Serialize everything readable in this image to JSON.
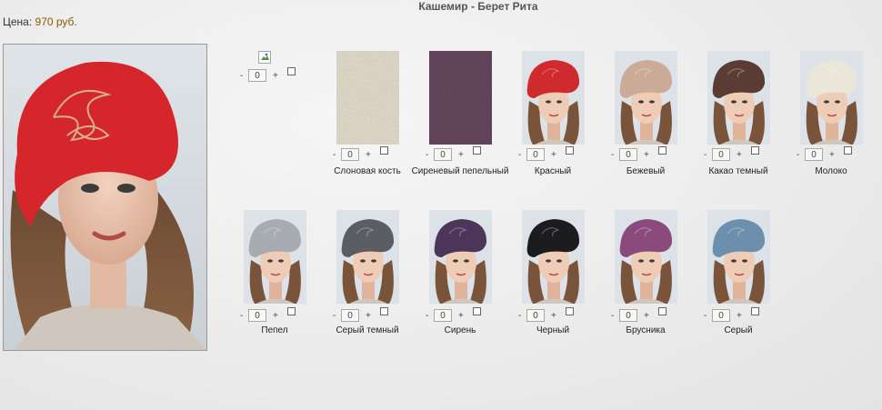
{
  "page": {
    "title": "Кашемир - Берет Рита",
    "price_label": "Цена:",
    "price_value": "970 руб."
  },
  "main_photo": {
    "hat_color": "#d5272b"
  },
  "items_row1": [
    {
      "name": "",
      "qty": "0",
      "broken": true
    },
    {
      "name": "Слоновая кость",
      "qty": "0",
      "swatch": "#efe6d6"
    },
    {
      "name": "Сиреневый пепельный",
      "qty": "0",
      "swatch": "#6b4a62"
    },
    {
      "name": "Красный",
      "qty": "0",
      "hat": "#cf2a2e"
    },
    {
      "name": "Бежевый",
      "qty": "0",
      "hat": "#c9ab98"
    },
    {
      "name": "Какао темный",
      "qty": "0",
      "hat": "#5a3c34"
    },
    {
      "name": "Молоко",
      "qty": "0",
      "hat": "#ebe6da"
    }
  ],
  "items_row2": [
    {
      "name": "Пепел",
      "qty": "0",
      "hat": "#a8acb0"
    },
    {
      "name": "Серый темный",
      "qty": "0",
      "hat": "#5a5e62"
    },
    {
      "name": "Сирень",
      "qty": "0",
      "hat": "#4b3558"
    },
    {
      "name": "Черный",
      "qty": "0",
      "hat": "#1c1c1e"
    },
    {
      "name": "Брусника",
      "qty": "0",
      "hat": "#8a4a7c"
    },
    {
      "name": "Серый",
      "qty": "0",
      "hat": "#6d8fae"
    }
  ],
  "controls": {
    "minus": "-",
    "plus": "+"
  }
}
